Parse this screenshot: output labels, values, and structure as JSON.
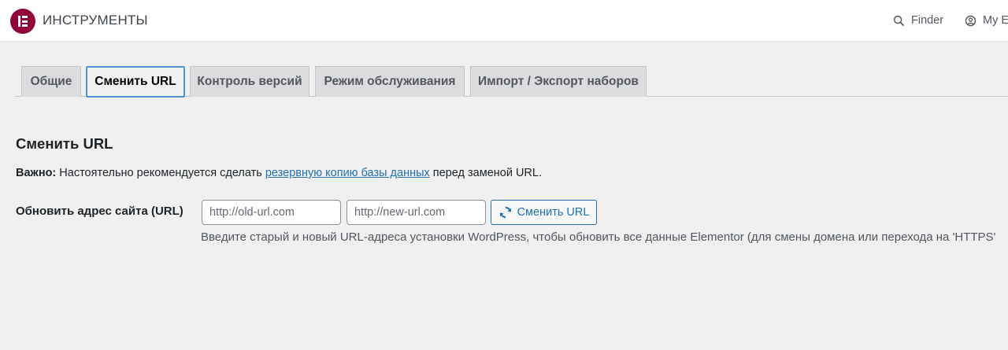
{
  "header": {
    "title": "ИНСТРУМЕНТЫ",
    "logo_icon": "elementor-logo",
    "brand_color": "#92003b",
    "finder_label": "Finder",
    "account_label": "My El"
  },
  "tabs": [
    {
      "label": "Общие",
      "active": false
    },
    {
      "label": "Сменить URL",
      "active": true
    },
    {
      "label": "Контроль версий",
      "active": false
    },
    {
      "label": "Режим обслуживания",
      "active": false
    },
    {
      "label": "Импорт / Экспорт наборов",
      "active": false
    }
  ],
  "section": {
    "title": "Сменить URL",
    "notice_strong": "Важно:",
    "notice_before": " Настоятельно рекомендуется сделать ",
    "notice_link": "резервную копию базы данных",
    "notice_after": " перед заменой URL."
  },
  "replace_url": {
    "label": "Обновить адрес сайта (URL)",
    "old_placeholder": "http://old-url.com",
    "old_value": "",
    "new_placeholder": "http://new-url.com",
    "new_value": "",
    "button_label": "Сменить URL",
    "button_icon": "sync-icon",
    "description": "Введите старый и новый URL-адреса установки WordPress, чтобы обновить все данные Elementor (для смены домена или перехода на 'HTTPS'"
  },
  "colors": {
    "link": "#2271b1",
    "active_tab_border": "#4f94d4",
    "background": "#f0f0f1"
  }
}
